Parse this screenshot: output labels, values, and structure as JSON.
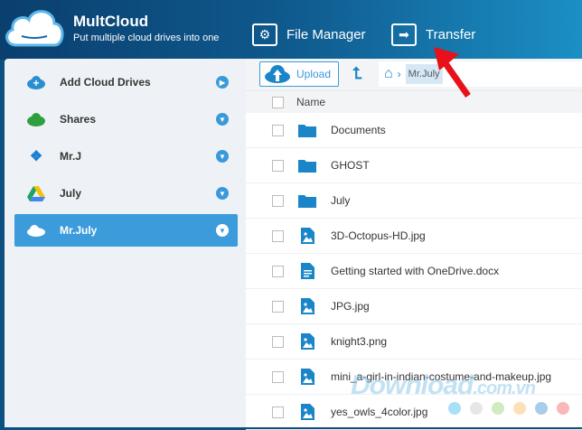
{
  "header": {
    "brand": "MultCloud",
    "tagline": "Put multiple cloud drives into one",
    "nav": [
      {
        "label": "File Manager",
        "icon": "gear-icon"
      },
      {
        "label": "Transfer",
        "icon": "arrow-right-icon"
      }
    ]
  },
  "sidebar": {
    "items": [
      {
        "label": "Add Cloud Drives",
        "icon": "add-cloud-icon"
      },
      {
        "label": "Shares",
        "icon": "share-icon"
      },
      {
        "label": "Mr.J",
        "icon": "dropbox-icon"
      },
      {
        "label": "July",
        "icon": "google-drive-icon"
      },
      {
        "label": "Mr.July",
        "icon": "onedrive-icon",
        "active": true
      }
    ]
  },
  "toolbar": {
    "upload_label": "Upload",
    "breadcrumb_current": "Mr.July"
  },
  "list": {
    "column_name": "Name",
    "files": [
      {
        "name": "Documents",
        "type": "folder"
      },
      {
        "name": "GHOST",
        "type": "folder"
      },
      {
        "name": "July",
        "type": "folder"
      },
      {
        "name": "3D-Octopus-HD.jpg",
        "type": "image"
      },
      {
        "name": "Getting started with OneDrive.docx",
        "type": "doc"
      },
      {
        "name": "JPG.jpg",
        "type": "image"
      },
      {
        "name": "knight3.png",
        "type": "image"
      },
      {
        "name": "mini_a-girl-in-indian-costume-and-makeup.jpg",
        "type": "image"
      },
      {
        "name": "yes_owls_4color.jpg",
        "type": "image"
      }
    ]
  },
  "watermark": {
    "text": "Download",
    "suffix": ".com.vn",
    "dot_colors": [
      "#a8e0f8",
      "#e6e6e6",
      "#d2eac0",
      "#fde0b8",
      "#a8cdea",
      "#fbb8b8"
    ]
  },
  "colors": {
    "accent": "#3a9ad9",
    "annotation": "#e8101a"
  }
}
